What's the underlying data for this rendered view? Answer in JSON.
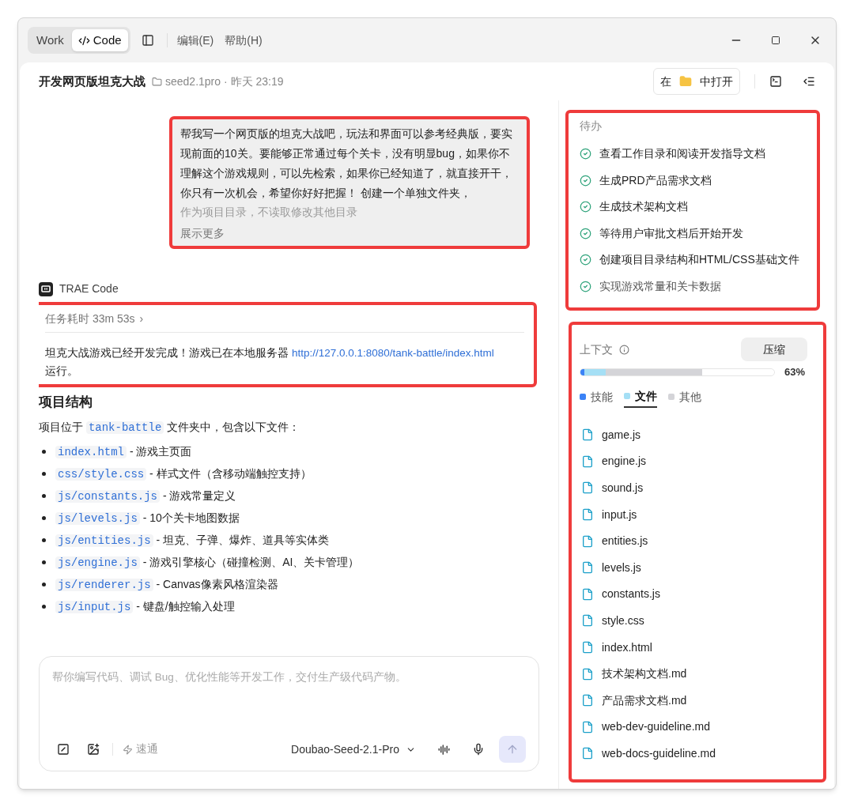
{
  "window": {
    "tabs": [
      {
        "label": "Work",
        "selected": false
      },
      {
        "label": "Code",
        "selected": true
      }
    ],
    "menu": [
      "编辑(E)",
      "帮助(H)"
    ]
  },
  "header": {
    "title": "开发网页版坦克大战",
    "folder": "seed2.1pro",
    "time": "· 昨天 23:19",
    "open_prefix": "在",
    "open_suffix": "中打开"
  },
  "user_message": {
    "text": "帮我写一个网页版的坦克大战吧，玩法和界面可以参考经典版，要实现前面的10关。要能够正常通过每个关卡，没有明显bug，如果你不理解这个游戏规则，可以先检索，如果你已经知道了，就直接开干，你只有一次机会，希望你好好把握！ 创建一个单独文件夹，",
    "faded_text": "作为项目目录，不读取修改其他目录",
    "more": "展示更多"
  },
  "assistant": {
    "name": "TRAE Code",
    "duration": "任务耗时 33m 53s",
    "chevron": "›",
    "summary": "坦克大战游戏已经开发完成！游戏已在本地服务器 ",
    "link": "http://127.0.0.1:8080/tank-battle/index.html",
    "summary_end": "运行。",
    "heading": "项目结构",
    "intro_before": "项目位于 ",
    "intro_code": "tank-battle",
    "intro_after": " 文件夹中，包含以下文件：",
    "files": [
      {
        "code": "index.html",
        "desc": " - 游戏主页面"
      },
      {
        "code": "css/style.css",
        "desc": " - 样式文件（含移动端触控支持）"
      },
      {
        "code": "js/constants.js",
        "desc": " - 游戏常量定义"
      },
      {
        "code": "js/levels.js",
        "desc": " - 10个关卡地图数据"
      },
      {
        "code": "js/entities.js",
        "desc": " - 坦克、子弹、爆炸、道具等实体类"
      },
      {
        "code": "js/engine.js",
        "desc": " - 游戏引擎核心（碰撞检测、AI、关卡管理）"
      },
      {
        "code": "js/renderer.js",
        "desc": " - Canvas像素风格渲染器"
      },
      {
        "code": "js/input.js",
        "desc": " - 键盘/触控输入处理"
      }
    ]
  },
  "composer": {
    "placeholder": "帮你编写代码、调试 Bug、优化性能等开发工作，交付生产级代码产物。",
    "mode": "速通",
    "model": "Doubao-Seed-2.1-Pro"
  },
  "todo": {
    "title": "待办",
    "items": [
      {
        "label": "查看工作目录和阅读开发指导文档",
        "done": true
      },
      {
        "label": "生成PRD产品需求文档",
        "done": true
      },
      {
        "label": "生成技术架构文档",
        "done": true
      },
      {
        "label": "等待用户审批文档后开始开发",
        "done": true
      },
      {
        "label": "创建项目目录结构和HTML/CSS基础文件",
        "done": true
      },
      {
        "label": "实现游戏常量和关卡数据",
        "done": true
      }
    ]
  },
  "context": {
    "title": "上下文",
    "compress": "压缩",
    "percent": "63%",
    "bar": [
      {
        "color": "#d4d4d8",
        "level": 0.63
      },
      {
        "color": "#a5dff5",
        "level": 0.13
      },
      {
        "color": "#3b82f6",
        "level": 0.02
      }
    ],
    "segments": [
      {
        "name": "技能",
        "color": "#3b82f6",
        "selected": false
      },
      {
        "name": "文件",
        "color": "#a5dff5",
        "selected": true
      },
      {
        "name": "其他",
        "color": "#d4d4d8",
        "selected": false
      }
    ],
    "files": [
      "game.js",
      "engine.js",
      "sound.js",
      "input.js",
      "entities.js",
      "levels.js",
      "constants.js",
      "style.css",
      "index.html",
      "技术架构文档.md",
      "产品需求文档.md",
      "web-dev-guideline.md",
      "web-docs-guideline.md"
    ]
  }
}
